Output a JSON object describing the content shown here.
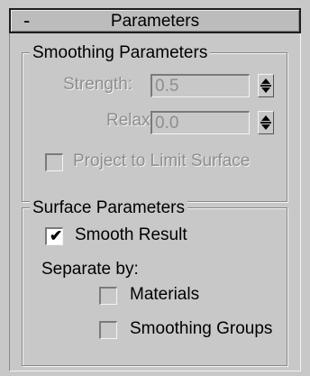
{
  "rollout": {
    "toggle": "-",
    "title": "Parameters"
  },
  "smoothing": {
    "title": "Smoothing Parameters",
    "strength_label": "Strength:",
    "strength_value": "0.5",
    "relax_label": "Relax:",
    "relax_value": "0.0",
    "project_label": "Project to Limit Surface",
    "project_checked": false,
    "enabled": false
  },
  "surface": {
    "title": "Surface Parameters",
    "smooth_result_label": "Smooth Result",
    "smooth_result_checked": true,
    "separate_by_label": "Separate by:",
    "materials_label": "Materials",
    "materials_checked": false,
    "smoothing_groups_label": "Smoothing Groups",
    "smoothing_groups_checked": false
  },
  "icons": {
    "checkmark": "check-icon",
    "spinner": "spinner-arrows-icon"
  },
  "colors": {
    "background": "#c8c8c8",
    "disabled_text": "#8e8e8e"
  }
}
